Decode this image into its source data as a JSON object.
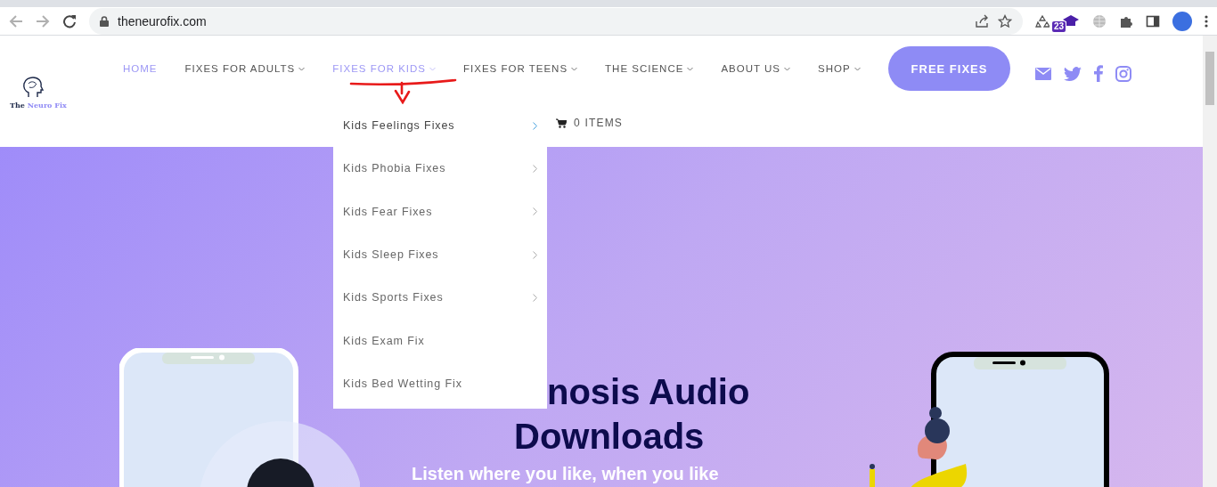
{
  "browser": {
    "url": "theneurofix.com",
    "extension_badge": "23"
  },
  "logo": {
    "text_dark": "The",
    "text_accent": "Neuro Fix"
  },
  "nav": [
    {
      "label": "HOME",
      "highlighted": true,
      "caret": false
    },
    {
      "label": "FIXES FOR ADULTS",
      "highlighted": false,
      "caret": true
    },
    {
      "label": "FIXES FOR KIDS",
      "highlighted": true,
      "caret": true
    },
    {
      "label": "FIXES FOR TEENS",
      "highlighted": false,
      "caret": true
    },
    {
      "label": "THE SCIENCE",
      "highlighted": false,
      "caret": true
    },
    {
      "label": "ABOUT US",
      "highlighted": false,
      "caret": true
    },
    {
      "label": "SHOP",
      "highlighted": false,
      "caret": true
    }
  ],
  "cta": "FREE FIXES",
  "cart": "0 ITEMS",
  "dropdown": [
    {
      "label": "Kids Feelings Fixes",
      "submenu": true,
      "selected": true
    },
    {
      "label": "Kids Phobia Fixes",
      "submenu": true,
      "selected": false
    },
    {
      "label": "Kids Fear Fixes",
      "submenu": true,
      "selected": false
    },
    {
      "label": "Kids Sleep Fixes",
      "submenu": true,
      "selected": false
    },
    {
      "label": "Kids Sports Fixes",
      "submenu": true,
      "selected": false
    },
    {
      "label": "Kids Exam Fix",
      "submenu": false,
      "selected": false
    },
    {
      "label": "Kids Bed Wetting Fix",
      "submenu": false,
      "selected": false
    }
  ],
  "hero": {
    "title_line_1": "nosis Audio",
    "title_line_2": "Downloads",
    "subtitle": "Listen where you like, when you like"
  }
}
